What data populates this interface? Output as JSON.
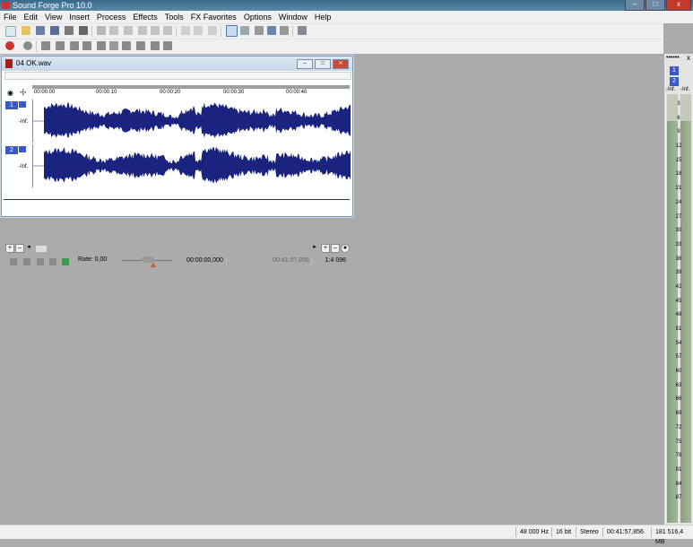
{
  "window": {
    "title": "Sound Forge Pro 10.0",
    "min": "",
    "max": "",
    "close": "x"
  },
  "menu": [
    "File",
    "Edit",
    "View",
    "Insert",
    "Process",
    "Effects",
    "Tools",
    "FX Favorites",
    "Options",
    "Window",
    "Help"
  ],
  "menu_close": "x",
  "meters": {
    "header": "••••••",
    "close": "x",
    "ch1": "1",
    "ch2": "2",
    "inf_left": "-Inf.",
    "inf_right": "-Inf.",
    "scale": [
      "3",
      "6",
      "9",
      "12",
      "15",
      "18",
      "21",
      "24",
      "27",
      "30",
      "33",
      "36",
      "39",
      "42",
      "45",
      "48",
      "51",
      "54",
      "57",
      "60",
      "63",
      "66",
      "69",
      "72",
      "75",
      "78",
      "81",
      "84",
      "87"
    ]
  },
  "data_window": {
    "filename": "04 OK.wav",
    "ruler": [
      "00:00:00",
      "00:00:10",
      "00:00:20",
      "00:00:30",
      "00:00:40"
    ],
    "channel1": "1",
    "channel2": "2",
    "inf1": "-Inf.",
    "inf2": "-Inf.",
    "rate_label": "Rate: 0,00",
    "position": "00:00:00,000",
    "length": "00:41:57,856",
    "zoom": "1:4 096",
    "wave_color": "#1a237e"
  },
  "status": {
    "sample_rate": "48 000 Hz",
    "bit_depth": "16 bit",
    "channels": "Stereo",
    "length": "00:41:57,856",
    "disk": "181 516,4 MB"
  }
}
